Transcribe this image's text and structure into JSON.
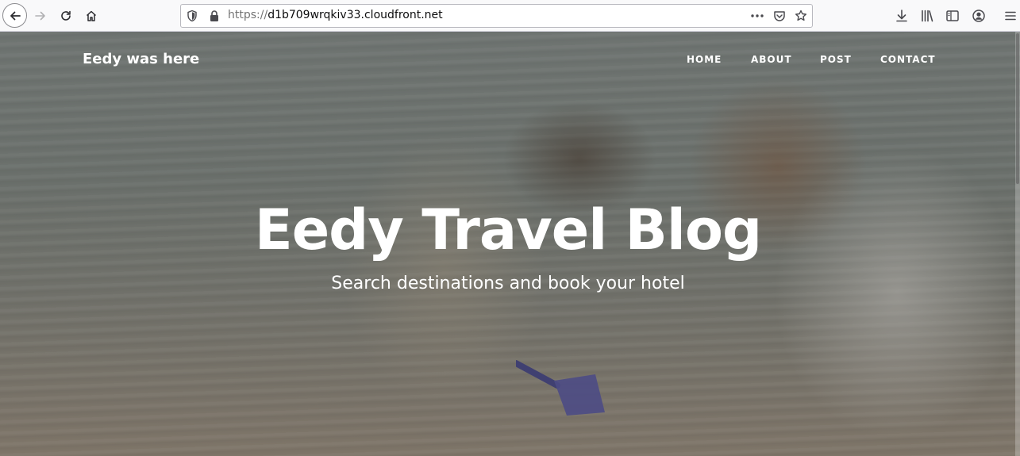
{
  "browser": {
    "url_scheme": "https://",
    "url_host": "d1b709wrqkiv33.cloudfront.net",
    "icons": {
      "back": "back-arrow-icon",
      "forward": "forward-arrow-icon",
      "reload": "reload-icon",
      "home": "home-icon",
      "tracking_protection": "shield-icon",
      "secure": "lock-icon",
      "page_actions": "more-dots-icon",
      "pocket": "pocket-icon",
      "bookmark": "star-icon",
      "downloads": "download-icon",
      "library": "library-icon",
      "sidebar": "sidebar-icon",
      "account": "account-icon",
      "menu": "hamburger-menu-icon"
    }
  },
  "site": {
    "brand": "Eedy was here",
    "nav": {
      "home": "HOME",
      "about": "ABOUT",
      "post": "POST",
      "contact": "CONTACT"
    },
    "hero": {
      "title": "Eedy Travel Blog",
      "subtitle": "Search destinations and book your hotel"
    }
  },
  "colors": {
    "text_on_hero": "#ffffff",
    "toolbar_bg": "#f9f9fa",
    "scoop": "#5b5aa8"
  }
}
